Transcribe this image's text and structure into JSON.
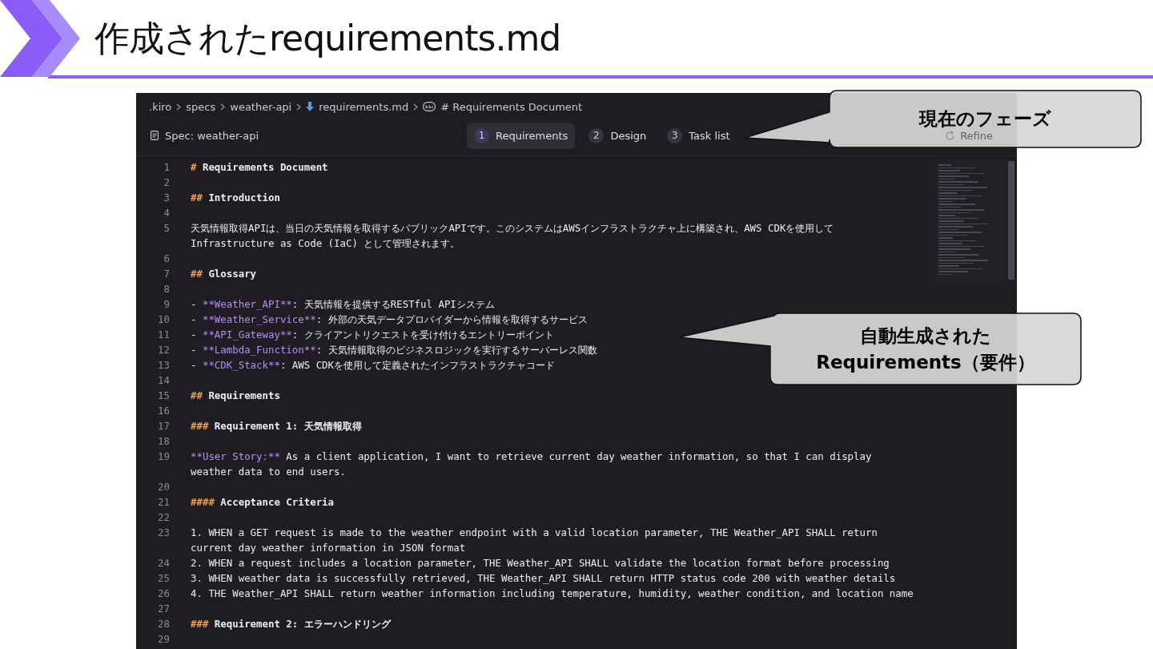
{
  "slide": {
    "title": "作成されたrequirements.md"
  },
  "editor": {
    "breadcrumb": [
      {
        "kind": "folder",
        "label": ".kiro"
      },
      {
        "kind": "folder",
        "label": "specs"
      },
      {
        "kind": "folder",
        "label": "weather-api"
      },
      {
        "kind": "file",
        "label": "requirements.md"
      },
      {
        "kind": "symbol",
        "label": "# Requirements Document"
      }
    ],
    "spec_label": "Spec: weather-api",
    "tabs": [
      {
        "number": "1",
        "label": "Requirements",
        "selected": true
      },
      {
        "number": "2",
        "label": "Design",
        "selected": false
      },
      {
        "number": "3",
        "label": "Task list",
        "selected": false
      }
    ],
    "refine_button": "Refine",
    "lines": [
      {
        "n": "1",
        "kind": "heading",
        "marker": "#",
        "text": "Requirements Document"
      },
      {
        "n": "2",
        "kind": "blank"
      },
      {
        "n": "3",
        "kind": "heading",
        "marker": "##",
        "text": "Introduction"
      },
      {
        "n": "4",
        "kind": "blank"
      },
      {
        "n": "5",
        "kind": "text",
        "text": "天気情報取得APIは、当日の天気情報を取得するパブリックAPIです。このシステムはAWSインフラストラクチャ上に構築され、AWS CDKを使用して",
        "wrap": "Infrastructure as Code (IaC) として管理されます。"
      },
      {
        "n": "6",
        "kind": "blank"
      },
      {
        "n": "7",
        "kind": "heading",
        "marker": "##",
        "text": "Glossary"
      },
      {
        "n": "8",
        "kind": "blank"
      },
      {
        "n": "9",
        "kind": "term",
        "dash": "- ",
        "term": "**Weather_API**",
        "text": ": 天気情報を提供するRESTful APIシステム"
      },
      {
        "n": "10",
        "kind": "term",
        "dash": "- ",
        "term": "**Weather_Service**",
        "text": ": 外部の天気データプロバイダーから情報を取得するサービス"
      },
      {
        "n": "11",
        "kind": "term",
        "dash": "- ",
        "term": "**API_Gateway**",
        "text": ": クライアントリクエストを受け付けるエントリーポイント"
      },
      {
        "n": "12",
        "kind": "term",
        "dash": "- ",
        "term": "**Lambda_Function**",
        "text": ": 天気情報取得のビジネスロジックを実行するサーバーレス関数"
      },
      {
        "n": "13",
        "kind": "term",
        "dash": "- ",
        "term": "**CDK_Stack**",
        "text": ": AWS CDKを使用して定義されたインフラストラクチャコード"
      },
      {
        "n": "14",
        "kind": "blank"
      },
      {
        "n": "15",
        "kind": "heading",
        "marker": "##",
        "text": "Requirements"
      },
      {
        "n": "16",
        "kind": "blank"
      },
      {
        "n": "17",
        "kind": "heading",
        "marker": "###",
        "text": "Requirement 1: 天気情報取得"
      },
      {
        "n": "18",
        "kind": "blank"
      },
      {
        "n": "19",
        "kind": "term",
        "term": "**User Story:**",
        "text": " As a client application, I want to retrieve current day weather information, so that I can display",
        "wrap": "weather data to end users."
      },
      {
        "n": "20",
        "kind": "blank"
      },
      {
        "n": "21",
        "kind": "heading",
        "marker": "####",
        "text": "Acceptance Criteria"
      },
      {
        "n": "22",
        "kind": "blank"
      },
      {
        "n": "23",
        "kind": "text",
        "text": "1. WHEN a GET request is made to the weather endpoint with a valid location parameter, THE Weather_API SHALL return",
        "wrap": "current day weather information in JSON format"
      },
      {
        "n": "24",
        "kind": "text",
        "text": "2. WHEN a request includes a location parameter, THE Weather_API SHALL validate the location format before processing"
      },
      {
        "n": "25",
        "kind": "text",
        "text": "3. WHEN weather data is successfully retrieved, THE Weather_API SHALL return HTTP status code 200 with weather details"
      },
      {
        "n": "26",
        "kind": "text",
        "text": "4. THE Weather_API SHALL return weather information including temperature, humidity, weather condition, and location name"
      },
      {
        "n": "27",
        "kind": "blank"
      },
      {
        "n": "28",
        "kind": "heading",
        "marker": "###",
        "text": "Requirement 2: エラーハンドリング"
      },
      {
        "n": "29",
        "kind": "blank"
      }
    ]
  },
  "callouts": [
    {
      "lines": [
        "現在のフェーズ"
      ]
    },
    {
      "lines": [
        "自動生成された",
        "Requirements（要件）"
      ]
    }
  ]
}
